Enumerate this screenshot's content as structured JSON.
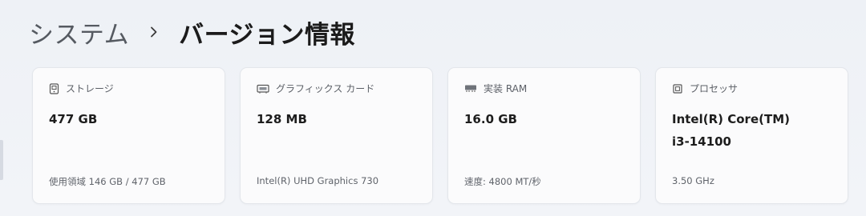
{
  "breadcrumb": {
    "parent": "システム",
    "separator_icon": "chevron-right-icon",
    "current": "バージョン情報"
  },
  "cards": [
    {
      "icon": "storage-icon",
      "label": "ストレージ",
      "value": "477 GB",
      "detail": "使用領域 146 GB / 477 GB"
    },
    {
      "icon": "graphics-card-icon",
      "label": "グラフィックス カード",
      "value": "128 MB",
      "detail": "Intel(R) UHD Graphics 730"
    },
    {
      "icon": "ram-icon",
      "label": "実装 RAM",
      "value": "16.0 GB",
      "detail": "速度: 4800 MT/秒"
    },
    {
      "icon": "processor-icon",
      "label": "プロセッサ",
      "value": "Intel(R) Core(TM)\ni3-14100",
      "detail": "3.50 GHz"
    }
  ]
}
